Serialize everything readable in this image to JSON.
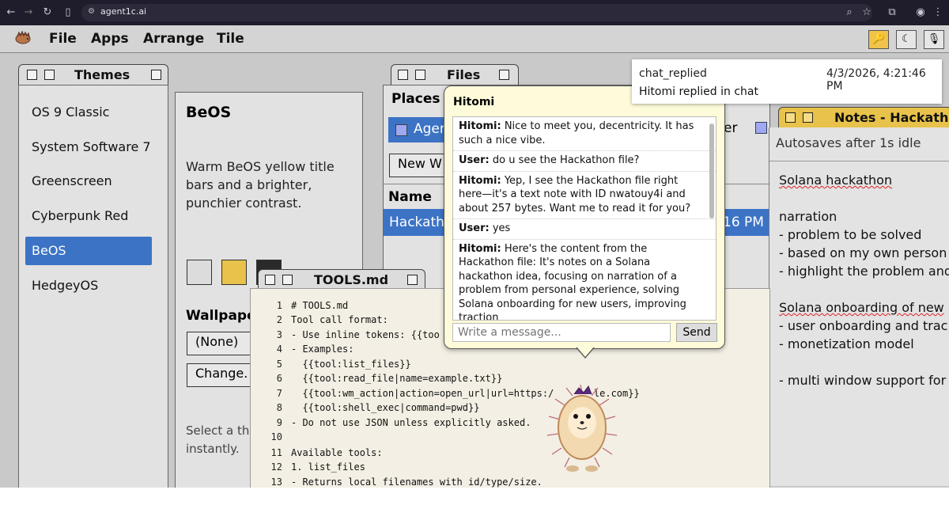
{
  "browser": {
    "url": "agent1c.ai"
  },
  "menubar": {
    "items": [
      "File",
      "Apps",
      "Arrange",
      "Tile"
    ]
  },
  "themes": {
    "title": "Themes",
    "items": [
      "OS 9 Classic",
      "System Software 7",
      "Greenscreen",
      "Cyberpunk Red",
      "BeOS",
      "HedgeyOS"
    ],
    "detail_title": "BeOS",
    "detail_desc": "Warm BeOS yellow title bars and a brighter, punchier contrast.",
    "swatch_colors": [
      "#dcdcdc",
      "#e8c24a",
      "#2a2a2a"
    ],
    "wallpaper_label": "Wallpape",
    "wallpaper_value": "(None)",
    "change_button": "Change.",
    "hint_line1": "Select a th",
    "hint_line2": "instantly."
  },
  "files": {
    "title": "Files",
    "places_label": "Places",
    "place_item": "Agen",
    "place_item_right": "er",
    "new_button": "New W",
    "column_name": "Name",
    "row_name": "Hackatho",
    "row_time": "16 PM"
  },
  "notification": {
    "event": "chat_replied",
    "timestamp": "4/3/2026, 4:21:46 PM",
    "message": "Hitomi replied in chat"
  },
  "chat": {
    "title": "Hitomi",
    "messages": [
      {
        "sender": "Hitomi:",
        "text": " Nice to meet you, decentricity. It has such a nice vibe."
      },
      {
        "sender": "User:",
        "text": " do u see the Hackathon file?"
      },
      {
        "sender": "Hitomi:",
        "text": " Yep, I see the Hackathon file right here—it's a text note with ID nwatouy4i and about 257 bytes. Want me to read it for you?"
      },
      {
        "sender": "User:",
        "text": " yes"
      },
      {
        "sender": "Hitomi:",
        "text": " Here's the content from the Hackathon file: It's notes on a Solana hackathon idea, focusing on narration of a problem from personal experience, solving Solana onboarding for new users, improving traction"
      }
    ],
    "input_placeholder": "Write a message...",
    "send_label": "Send"
  },
  "tools": {
    "title": "TOOLS.md",
    "lines": [
      "# TOOLS.md",
      "Tool call format:",
      "- Use inline tokens: {{too",
      "- Examples:",
      "  {{tool:list_files}}",
      "  {{tool:read_file|name=example.txt}}",
      "  {{tool:wm_action|action=open_url|url=https:/       le.com}}",
      "  {{tool:shell_exec|command=pwd}}",
      "- Do not use JSON unless explicitly asked.",
      "",
      "Available tools:",
      "1. list_files",
      "- Returns local filenames with id/type/size."
    ]
  },
  "notes": {
    "title": "Notes - Hackatho",
    "subtitle": "Autosaves after 1s idle",
    "lines": [
      "Solana hackathon",
      "",
      "narration",
      "- problem to be solved",
      "- based on my own person",
      "- highlight the problem and",
      "",
      "Solana onboarding of new",
      "- user onboarding and trac",
      "- monetization model",
      "",
      "- multi window support for"
    ]
  },
  "colors": {
    "accent": "#3c73c5",
    "title_yellow": "#e8c24a",
    "chat_bg": "#fdfbda"
  }
}
